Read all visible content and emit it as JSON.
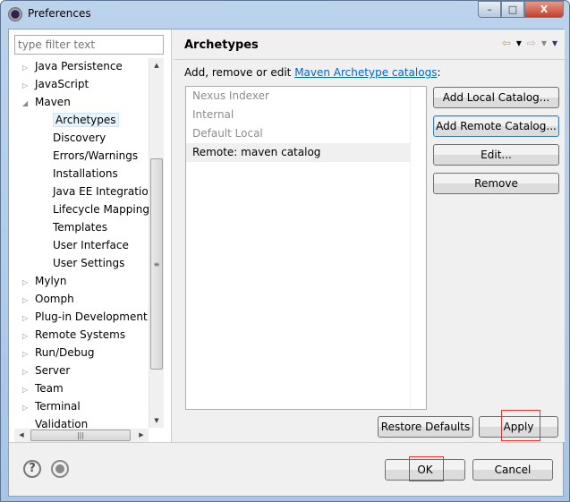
{
  "window": {
    "title": "Preferences",
    "minimize": "–",
    "maximize": "□",
    "close": "X"
  },
  "filter": {
    "placeholder": "type filter text"
  },
  "tree": [
    {
      "label": "Java Persistence",
      "expander": "▷",
      "level": 0
    },
    {
      "label": "JavaScript",
      "expander": "▷",
      "level": 0
    },
    {
      "label": "Maven",
      "expander": "◢",
      "level": 0
    },
    {
      "label": "Archetypes",
      "level": 1,
      "selected": true
    },
    {
      "label": "Discovery",
      "level": 1
    },
    {
      "label": "Errors/Warnings",
      "level": 1
    },
    {
      "label": "Installations",
      "level": 1
    },
    {
      "label": "Java EE Integration",
      "level": 1
    },
    {
      "label": "Lifecycle Mapping",
      "level": 1
    },
    {
      "label": "Templates",
      "level": 1
    },
    {
      "label": "User Interface",
      "level": 1
    },
    {
      "label": "User Settings",
      "level": 1
    },
    {
      "label": "Mylyn",
      "expander": "▷",
      "level": 0
    },
    {
      "label": "Oomph",
      "expander": "▷",
      "level": 0
    },
    {
      "label": "Plug-in Development",
      "expander": "▷",
      "level": 0
    },
    {
      "label": "Remote Systems",
      "expander": "▷",
      "level": 0
    },
    {
      "label": "Run/Debug",
      "expander": "▷",
      "level": 0
    },
    {
      "label": "Server",
      "expander": "▷",
      "level": 0
    },
    {
      "label": "Team",
      "expander": "▷",
      "level": 0
    },
    {
      "label": "Terminal",
      "expander": "▷",
      "level": 0
    },
    {
      "label": "Validation",
      "level": 0
    }
  ],
  "page": {
    "title": "Archetypes",
    "description_prefix": "Add, remove or edit ",
    "description_link": "Maven Archetype catalogs",
    "description_suffix": ":",
    "nav": {
      "back": "⇦",
      "back_menu": "▾",
      "forward": "⇨",
      "forward_menu": "▾",
      "view_menu": "▾"
    },
    "catalogs": [
      {
        "label": "Nexus Indexer",
        "enabled": false
      },
      {
        "label": "Internal",
        "enabled": false
      },
      {
        "label": "Default Local",
        "enabled": false
      },
      {
        "label": "Remote: maven catalog",
        "enabled": true,
        "selected": true
      }
    ],
    "buttons": {
      "add_local": "Add Local Catalog...",
      "add_remote": "Add Remote Catalog...",
      "edit": "Edit...",
      "remove": "Remove",
      "restore_defaults": "Restore Defaults",
      "apply": "Apply"
    }
  },
  "footer": {
    "help_icon": "?",
    "ok": "OK",
    "cancel": "Cancel"
  },
  "colors": {
    "link": "#0066cc",
    "highlight_box": "#e8302c"
  }
}
